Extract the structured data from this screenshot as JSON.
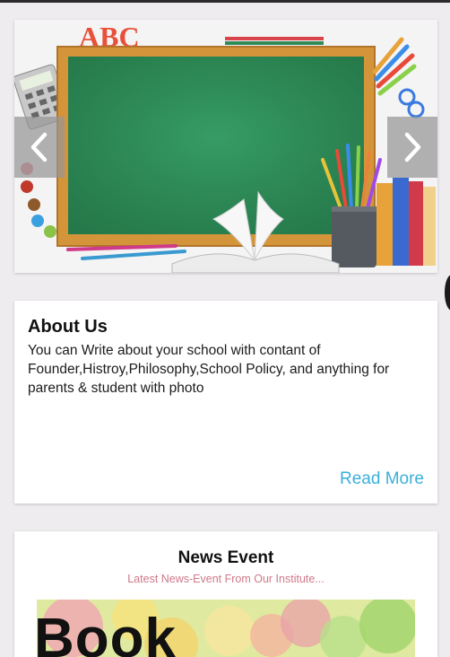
{
  "slider": {
    "image_name": "chalkboard-school-supplies",
    "image_letters": "ABC",
    "prev_icon": "chevron-left-icon",
    "next_icon": "chevron-right-icon"
  },
  "about": {
    "title": "About Us",
    "body": "You  can Write about your school with contant of Founder,Histroy,Philosophy,School Policy, and anything for parents & student with photo",
    "read_more": "Read More"
  },
  "news": {
    "title": "News Event",
    "subtitle": "Latest News-Event From Our Institute...",
    "image_text": "Book"
  },
  "colors": {
    "background": "#eeecee",
    "card": "#ffffff",
    "link": "#3bafd9",
    "subtitle": "#d0788a",
    "chalkboard": "#2e8b57",
    "frame": "#d4953a"
  }
}
